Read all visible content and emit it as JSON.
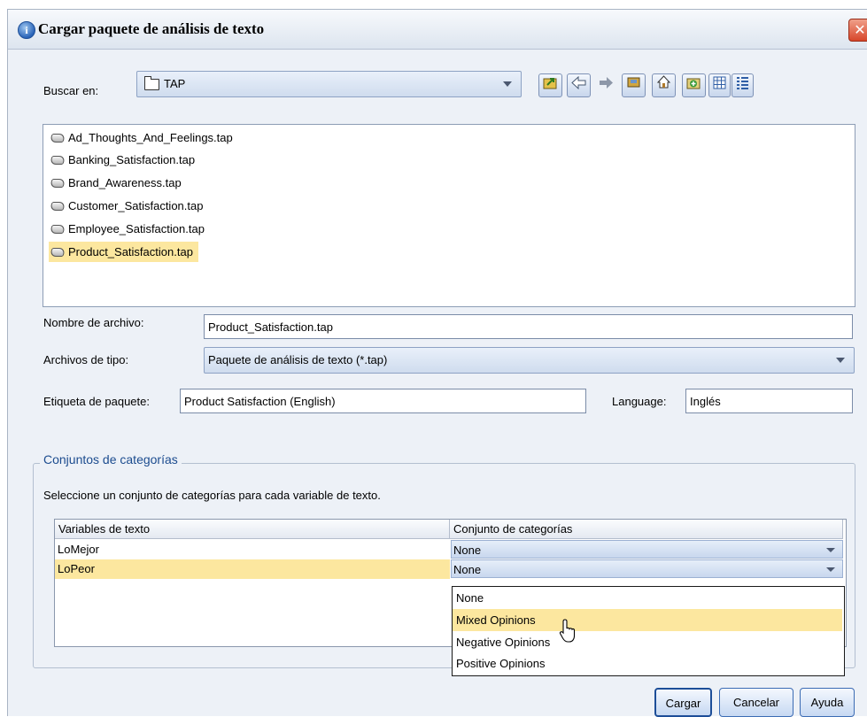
{
  "window": {
    "title": "Cargar paquete de análisis de texto",
    "close_glyph": "✕"
  },
  "lookin": {
    "label": "Buscar en:",
    "value": "TAP"
  },
  "toolbar": {
    "icons": [
      "folder-up-icon",
      "back-icon",
      "forward-icon",
      "desktop-icon",
      "home-icon",
      "new-folder-icon",
      "list-view-icon",
      "details-view-icon"
    ]
  },
  "files": [
    "Ad_Thoughts_And_Feelings.tap",
    "Banking_Satisfaction.tap",
    "Brand_Awareness.tap",
    "Customer_Satisfaction.tap",
    "Employee_Satisfaction.tap",
    "Product_Satisfaction.tap"
  ],
  "selected_file_index": 5,
  "filename": {
    "label": "Nombre de archivo:",
    "value": "Product_Satisfaction.tap"
  },
  "filetype": {
    "label": "Archivos de tipo:",
    "value": "Paquete de análisis de texto (*.tap)"
  },
  "package_label": {
    "label": "Etiqueta de paquete:",
    "value": "Product Satisfaction (English)"
  },
  "language": {
    "label": "Language:",
    "value": "Inglés"
  },
  "category_sets": {
    "legend": "Conjuntos de categorías",
    "instruction": "Seleccione un conjunto de categorías para cada variable de texto.",
    "columns": [
      "Variables de texto",
      "Conjunto de categorías"
    ],
    "rows": [
      {
        "variable": "LoMejor",
        "category_set": "None"
      },
      {
        "variable": "LoPeor",
        "category_set": "None"
      }
    ],
    "dropdown_options": [
      "None",
      "Mixed Opinions",
      "Negative Opinions",
      "Positive Opinions"
    ],
    "highlighted_option": "Mixed Opinions"
  },
  "buttons": {
    "load": "Cargar",
    "cancel": "Cancelar",
    "help": "Ayuda"
  },
  "colors": {
    "selection": "#fce79f",
    "accent": "#1c4c8f"
  }
}
